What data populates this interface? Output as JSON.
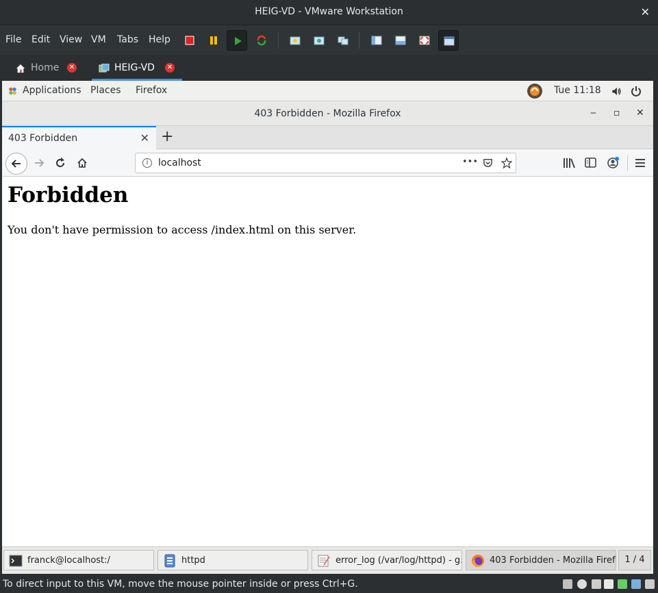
{
  "vmware": {
    "window_title": "HEIG-VD - VMware Workstation",
    "close_glyph": "✕",
    "menu": [
      "File",
      "Edit",
      "View",
      "VM",
      "Tabs",
      "Help"
    ],
    "tabs": [
      {
        "label": "Home",
        "icon": "home-icon"
      },
      {
        "label": "HEIG-VD",
        "icon": "vm-icon"
      }
    ],
    "tab_close_glyph": "✕",
    "status_message": "To direct input to this VM, move the mouse pointer inside or press Ctrl+G."
  },
  "gnome": {
    "applications": "Applications",
    "places": "Places",
    "firefox": "Firefox",
    "clock": "Tue 11:18"
  },
  "firefox": {
    "window_title": "403 Forbidden - Mozilla Firefox",
    "minimize": "‒",
    "maximize": "▫",
    "close": "✕",
    "tab_title": "403 Forbidden",
    "tab_close": "✕",
    "new_tab": "+",
    "url": "localhost",
    "page_actions": "•••"
  },
  "page": {
    "heading": "Forbidden",
    "message": "You don't have permission to access /index.html on this server."
  },
  "taskbar": {
    "items": [
      {
        "label": "franck@localhost:/",
        "icon": "terminal-icon"
      },
      {
        "label": "httpd",
        "icon": "file-manager-icon"
      },
      {
        "label": "error_log (/var/log/httpd) - g...",
        "icon": "text-editor-icon"
      },
      {
        "label": "403 Forbidden - Mozilla Firef...",
        "icon": "firefox-icon"
      }
    ],
    "workspace": "1 / 4"
  },
  "colors": {
    "accent": "#0a84ff",
    "vm_tab_close": "#dd3333"
  }
}
